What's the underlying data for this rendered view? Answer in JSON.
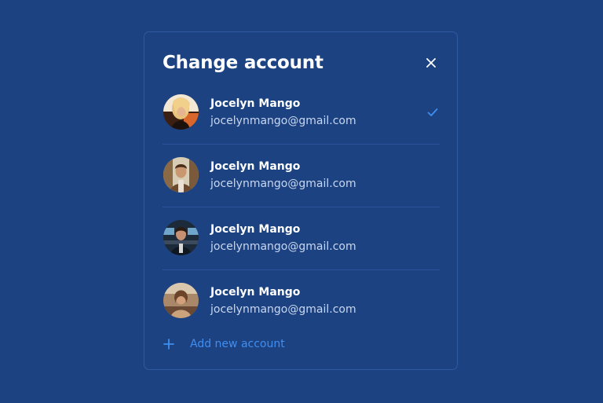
{
  "dialog": {
    "title": "Change account",
    "close_icon": "close-icon"
  },
  "accounts": [
    {
      "name": "Jocelyn Mango",
      "email": "jocelynmango@gmail.com",
      "selected": true
    },
    {
      "name": "Jocelyn Mango",
      "email": "jocelynmango@gmail.com",
      "selected": false
    },
    {
      "name": "Jocelyn Mango",
      "email": "jocelynmango@gmail.com",
      "selected": false
    },
    {
      "name": "Jocelyn Mango",
      "email": "jocelynmango@gmail.com",
      "selected": false
    }
  ],
  "add_account": {
    "label": "Add new account",
    "icon": "plus-icon"
  },
  "colors": {
    "background": "#1c4282",
    "accent": "#3f8ef0",
    "divider": "#2c549a",
    "text_primary": "#ffffff",
    "text_secondary": "#c9d7ef"
  }
}
